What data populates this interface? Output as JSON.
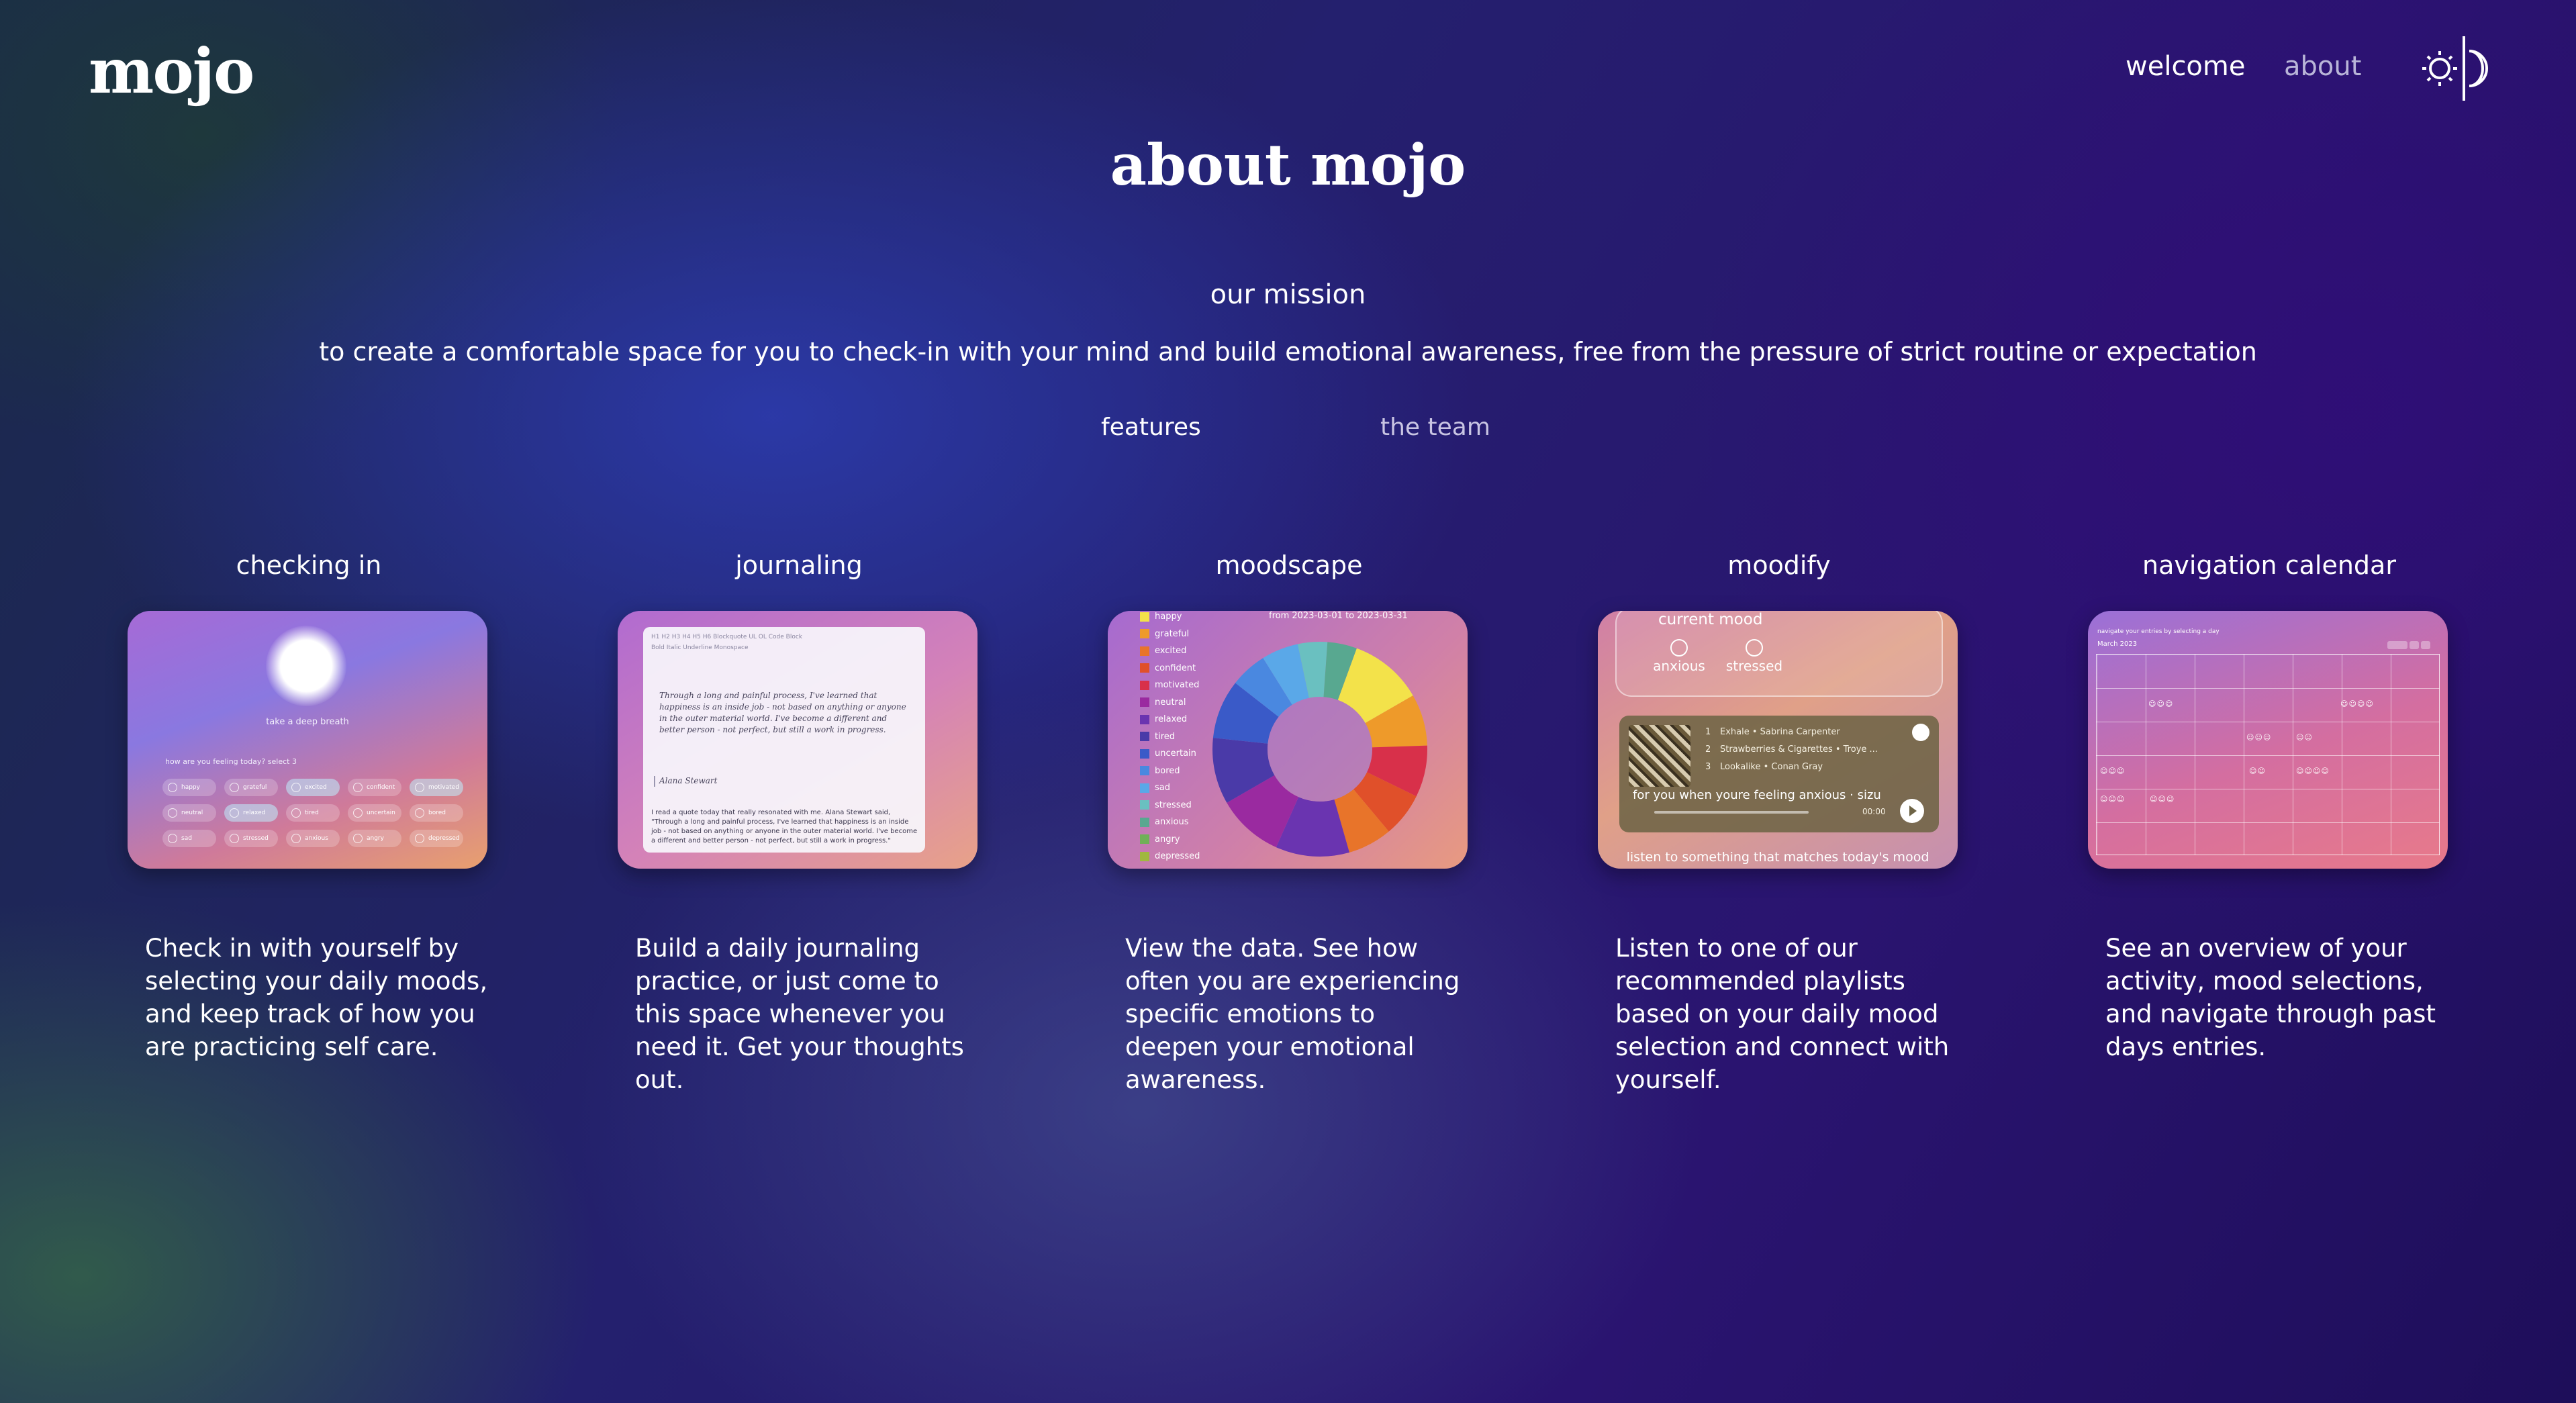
{
  "header": {
    "logo": "mojo",
    "nav": {
      "welcome": "welcome",
      "about": "about"
    },
    "theme_toggle_icon": "sun-moon-icon"
  },
  "page_title": "about mojo",
  "mission": {
    "heading": "our mission",
    "text": "to create a comfortable space for you to check-in with your mind and build emotional awareness, free from the pressure of strict routine or expectation"
  },
  "tabs": {
    "features": "features",
    "team": "the team"
  },
  "features": [
    {
      "title": "checking in",
      "description": "Check in with yourself by selecting your daily moods, and keep track of how you are practicing self care.",
      "preview": {
        "breath": "take a deep breath",
        "ask": "how are you feeling today? select 3",
        "moods": [
          "happy",
          "grateful",
          "excited",
          "confident",
          "motivated",
          "neutral",
          "relaxed",
          "tired",
          "uncertain",
          "bored",
          "sad",
          "stressed",
          "anxious",
          "angry",
          "depressed"
        ]
      }
    },
    {
      "title": "journaling",
      "description": "Build a daily journaling practice, or just come to this space whenever you need it. Get your thoughts out.",
      "preview": {
        "toolbar1": "H1  H2  H3  H4  H5  H6  Blockquote  UL  OL  Code Block",
        "toolbar2": "Bold  Italic  Underline  Monospace",
        "quote": "Through a long and painful process, I've learned that happiness is an inside job - not based on anything or anyone in the outer material world. I've become a different and better person - not perfect, but still a work in progress.",
        "author": "Alana Stewart",
        "entry": "I read a quote today that really resonated with me. Alana Stewart said, \"Through a long and painful process, I've learned that happiness is an inside job - not based on anything or anyone in the outer material world. I've become a different and better person - not perfect, but still a work in progress.\""
      }
    },
    {
      "title": "moodscape",
      "description": "View the data. See how often you are experiencing specific emotions to deepen your emotional awareness.",
      "preview": {
        "range": "from 2023-03-01 to 2023-03-31",
        "legend": [
          {
            "label": "happy",
            "color": "#f3e24a"
          },
          {
            "label": "grateful",
            "color": "#ee9a2a"
          },
          {
            "label": "excited",
            "color": "#e8742a"
          },
          {
            "label": "confident",
            "color": "#e0502a"
          },
          {
            "label": "motivated",
            "color": "#d8304a"
          },
          {
            "label": "neutral",
            "color": "#9a2aa0"
          },
          {
            "label": "relaxed",
            "color": "#6a34b0"
          },
          {
            "label": "tired",
            "color": "#4a3aa8"
          },
          {
            "label": "uncertain",
            "color": "#3a5ac8"
          },
          {
            "label": "bored",
            "color": "#4a88e0"
          },
          {
            "label": "sad",
            "color": "#5aa8e8"
          },
          {
            "label": "stressed",
            "color": "#6ac0c0"
          },
          {
            "label": "anxious",
            "color": "#58a890"
          },
          {
            "label": "angry",
            "color": "#70b058"
          },
          {
            "label": "depressed",
            "color": "#a0b840"
          }
        ]
      }
    },
    {
      "title": "moodify",
      "description": "Listen to one of our recommended playlists based on your daily mood selection and connect with yourself.",
      "preview": {
        "current_mood": "current mood",
        "moods": [
          "anxious",
          "stressed"
        ],
        "tracks": [
          {
            "n": "1",
            "text": "Exhale • Sabrina Carpenter"
          },
          {
            "n": "2",
            "text": "Strawberries & Cigarettes • Troye ..."
          },
          {
            "n": "3",
            "text": "Lookalike • Conan Gray"
          }
        ],
        "playlist": "for you when youre feeling anxious · sizu",
        "time": "00:00",
        "caption": "listen to something that matches today's mood"
      }
    },
    {
      "title": "navigation calendar",
      "description": "See an overview of your activity, mood selections, and navigate through past days entries.",
      "preview": {
        "hint": "navigate your entries by selecting a day",
        "month": "March 2023"
      }
    }
  ]
}
